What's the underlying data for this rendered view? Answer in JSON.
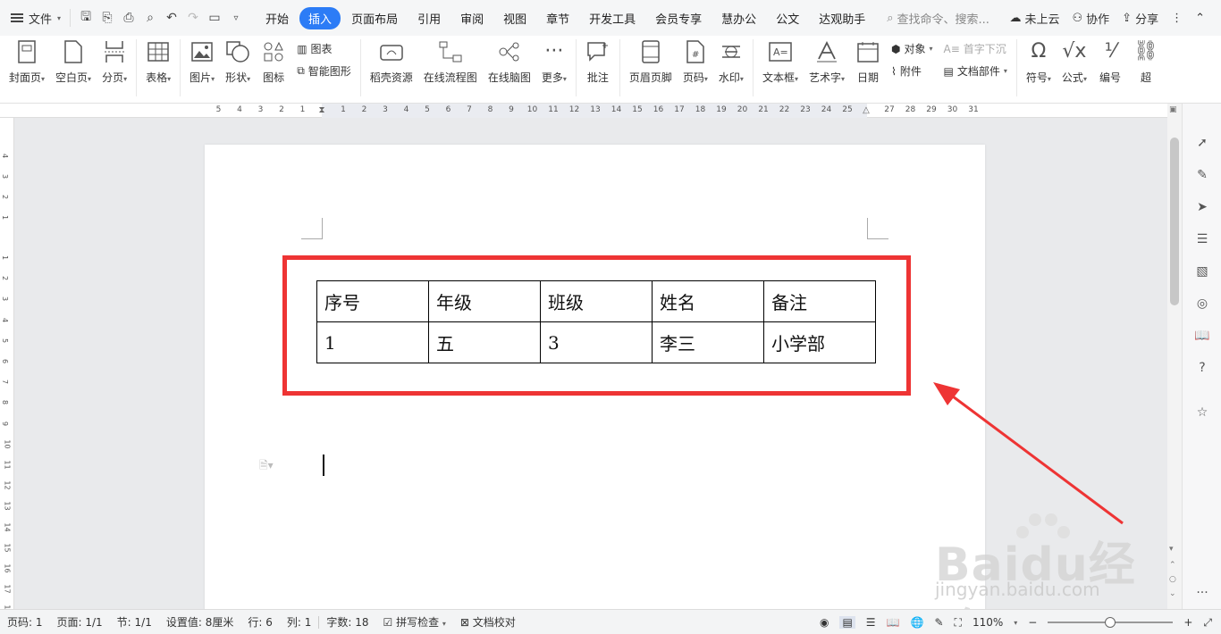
{
  "topbar": {
    "file_label": "文件",
    "tabs": [
      {
        "label": "开始"
      },
      {
        "label": "插入"
      },
      {
        "label": "页面布局"
      },
      {
        "label": "引用"
      },
      {
        "label": "审阅"
      },
      {
        "label": "视图"
      },
      {
        "label": "章节"
      },
      {
        "label": "开发工具"
      },
      {
        "label": "会员专享"
      },
      {
        "label": "慧办公"
      },
      {
        "label": "公文"
      },
      {
        "label": "达观助手"
      }
    ],
    "active_tab": "插入",
    "search_placeholder": "查找命令、搜索...",
    "cloud_label": "未上云",
    "collab_label": "协作",
    "share_label": "分享",
    "accent_color": "#2c7cf6"
  },
  "ribbon": {
    "cover": "封面页",
    "blank": "空白页",
    "page_break": "分页",
    "table": "表格",
    "picture": "图片",
    "shape": "形状",
    "icon": "图标",
    "chart": "图表",
    "smart_shape": "智能图形",
    "resources": "稻壳资源",
    "flowchart": "在线流程图",
    "mindmap": "在线脑图",
    "more": "更多",
    "comment": "批注",
    "header_footer": "页眉页脚",
    "page_number": "页码",
    "watermark": "水印",
    "textbox": "文本框",
    "wordart": "艺术字",
    "date": "日期",
    "object": "对象",
    "attachment": "附件",
    "dropcap": "首字下沉",
    "doc_parts": "文档部件",
    "symbol": "符号",
    "formula": "公式",
    "numbering": "编号",
    "overflow": "超"
  },
  "hruler_left": [
    "5",
    "4",
    "3",
    "2",
    "1"
  ],
  "hruler_right": [
    "1",
    "2",
    "3",
    "4",
    "5",
    "6",
    "7",
    "8",
    "9",
    "10",
    "11",
    "12",
    "13",
    "14",
    "15",
    "16",
    "17",
    "18",
    "19",
    "20",
    "21",
    "22",
    "23",
    "24",
    "25",
    "27",
    "28",
    "29",
    "30",
    "31"
  ],
  "vruler_top": [
    "4",
    "3",
    "2",
    "1"
  ],
  "vruler_main": [
    "1",
    "2",
    "3",
    "4",
    "5",
    "6",
    "7",
    "8",
    "9",
    "10",
    "11",
    "12",
    "13",
    "14",
    "15",
    "16",
    "17",
    "18"
  ],
  "table": {
    "header": [
      "序号",
      "年级",
      "班级",
      "姓名",
      "备注"
    ],
    "row": [
      "1",
      "五",
      "3",
      "李三",
      "小学部"
    ]
  },
  "highlight_color": "#ee3434",
  "watermark_text": "Baidu经验",
  "watermark_sub": "jingyan.baidu.com",
  "statusbar": {
    "page_code": "页码: 1",
    "pages": "页面: 1/1",
    "section": "节: 1/1",
    "setting": "设置值: 8厘米",
    "row": "行: 6",
    "col": "列: 1",
    "word_count": "字数: 18",
    "spellcheck": "拼写检查",
    "proofread": "文档校对",
    "zoom": "110%",
    "zoom_fraction": 0.5
  }
}
